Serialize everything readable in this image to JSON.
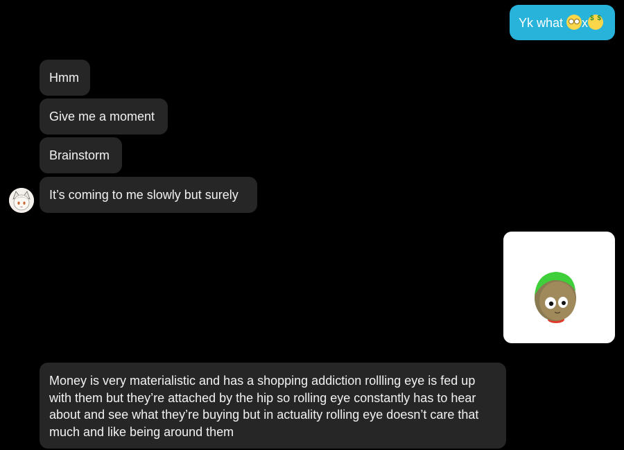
{
  "outgoing_first": {
    "text": "Yk what",
    "separator": "x",
    "emojis": [
      "face-with-rolling-eyes-icon",
      "money-mouth-face-icon"
    ]
  },
  "incoming_group": [
    {
      "text": "Hmm"
    },
    {
      "text": "Give me a moment"
    },
    {
      "text": "Brainstorm"
    },
    {
      "text": "It’s coming to me slowly but surely"
    }
  ],
  "sticker": {
    "icon": "cartoon-head-sticker-icon"
  },
  "incoming_long": {
    "text": "Money is very materialistic and has a shopping addiction rollling eye is fed up with them but they’re attached by the hip so rolling eye constantly has to hear about and see what they’re buying but in actuality rolling eye doesn’t care that much and like being around them"
  },
  "colors": {
    "background": "#000000",
    "incoming_bubble": "#262626",
    "outgoing_bubble": "#27b3da"
  }
}
